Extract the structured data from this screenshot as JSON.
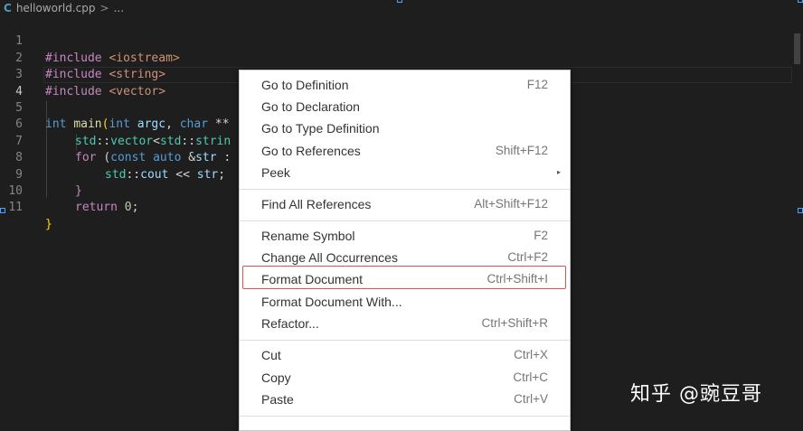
{
  "breadcrumb": {
    "file_icon": "C",
    "file": "helloworld.cpp",
    "separator": ">",
    "more": "..."
  },
  "editor": {
    "line_numbers": [
      "1",
      "2",
      "3",
      "4",
      "5",
      "6",
      "7",
      "8",
      "9",
      "10",
      "11"
    ],
    "lines": {
      "l1": [
        "#include ",
        "<iostream>"
      ],
      "l2": [
        "#include ",
        "<string>"
      ],
      "l3": [
        "#include ",
        "<vector>"
      ],
      "l5": [
        "int ",
        "main",
        "(",
        "int ",
        "argc",
        ", ",
        "char ",
        "**"
      ],
      "l6": [
        "std",
        "::",
        "vector",
        "<",
        "std",
        "::",
        "strin"
      ],
      "l7": [
        "for ",
        "(",
        "const ",
        "auto ",
        "&",
        "str",
        " :"
      ],
      "l8": [
        "std",
        "::",
        "cout ",
        "<< ",
        "str",
        ";"
      ],
      "l9": [
        "}"
      ],
      "l10": [
        "return ",
        "0",
        ";"
      ],
      "l11": [
        "}"
      ]
    }
  },
  "context_menu": {
    "groups": [
      [
        {
          "label": "Go to Definition",
          "shortcut": "F12"
        },
        {
          "label": "Go to Declaration",
          "shortcut": ""
        },
        {
          "label": "Go to Type Definition",
          "shortcut": ""
        },
        {
          "label": "Go to References",
          "shortcut": "Shift+F12"
        },
        {
          "label": "Peek",
          "shortcut": "",
          "submenu_arrow": "▸"
        }
      ],
      [
        {
          "label": "Find All References",
          "shortcut": "Alt+Shift+F12"
        }
      ],
      [
        {
          "label": "Rename Symbol",
          "shortcut": "F2"
        },
        {
          "label": "Change All Occurrences",
          "shortcut": "Ctrl+F2"
        },
        {
          "label": "Format Document",
          "shortcut": "Ctrl+Shift+I",
          "highlighted": true
        },
        {
          "label": "Format Document With...",
          "shortcut": ""
        },
        {
          "label": "Refactor...",
          "shortcut": "Ctrl+Shift+R"
        }
      ],
      [
        {
          "label": "Cut",
          "shortcut": "Ctrl+X"
        },
        {
          "label": "Copy",
          "shortcut": "Ctrl+C"
        },
        {
          "label": "Paste",
          "shortcut": "Ctrl+V"
        }
      ]
    ],
    "highlight_color": "#d9534f"
  },
  "watermark": "知乎 @豌豆哥",
  "colors": {
    "background": "#1e1e1e",
    "keyword": "#569cd6",
    "string": "#ce9178",
    "preprocessor": "#c586c0",
    "function": "#dcdcaa",
    "type": "#4ec9b0",
    "variable": "#9cdcfe",
    "number": "#b5cea8"
  }
}
